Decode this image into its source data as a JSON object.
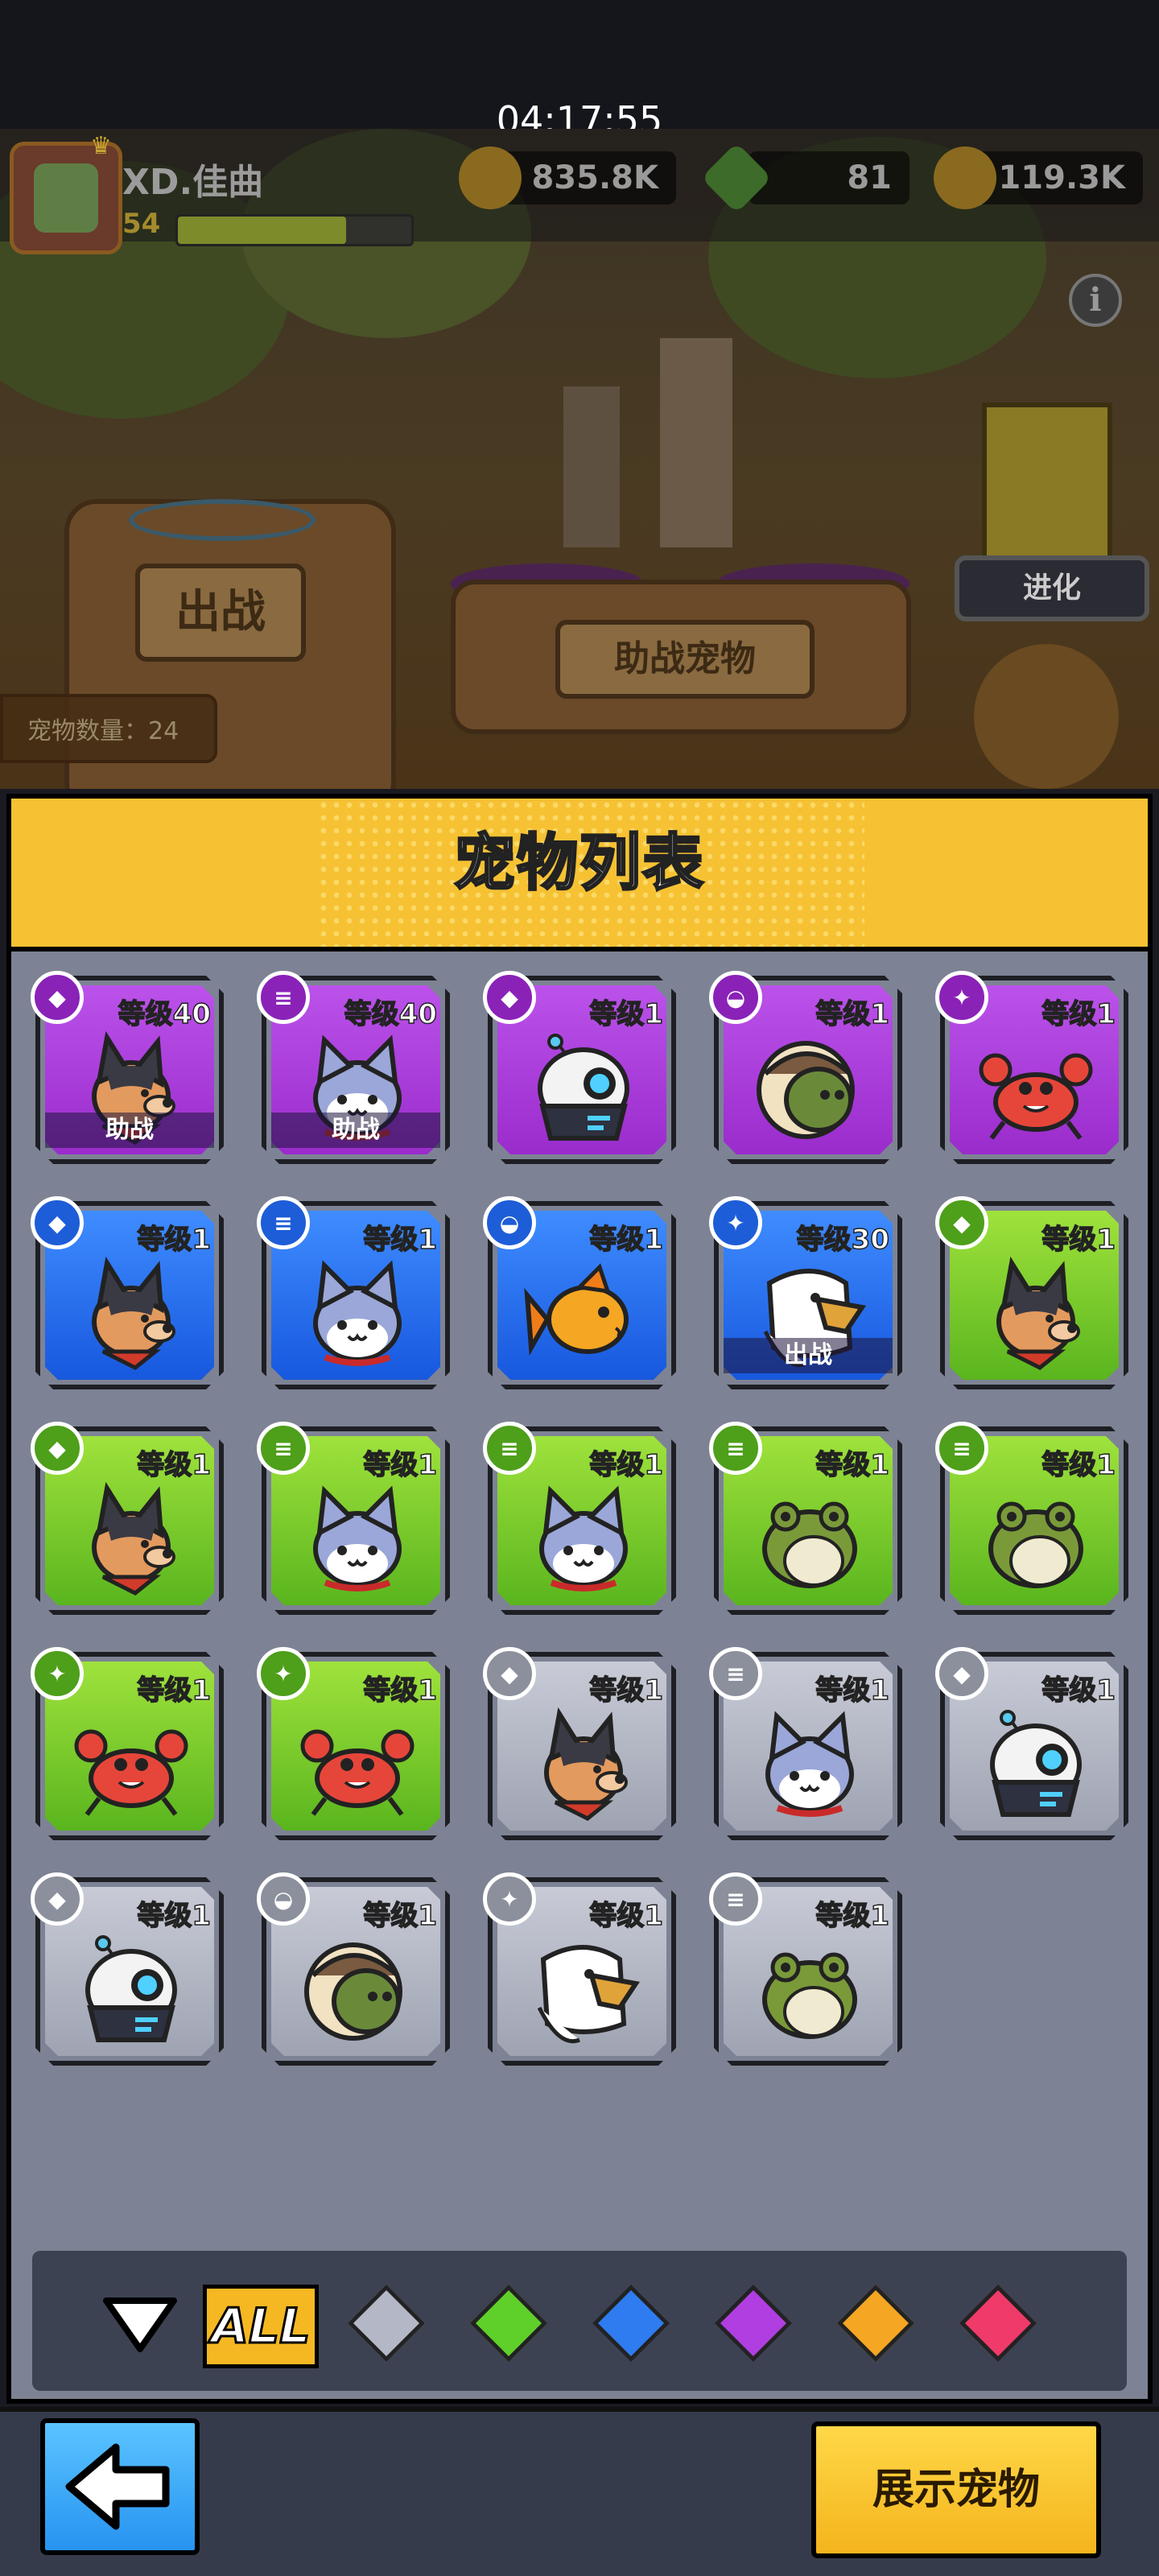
{
  "status_bar": {
    "time": "04:17:55"
  },
  "player": {
    "name": "XD.佳曲",
    "level": "54",
    "xp_fraction": 0.72
  },
  "resources": {
    "coins": "835.8K",
    "gems": "81",
    "gold": "119.3K"
  },
  "scene": {
    "battle_label": "出战",
    "assist_label": "助战宠物",
    "evolve_label": "进化",
    "pet_count_label": "宠物数量：24"
  },
  "panel": {
    "title": "宠物列表",
    "pets": [
      {
        "rarity": "purple",
        "pet": "dog",
        "badge": "dog-icon",
        "level": "等级40",
        "tag": "助战"
      },
      {
        "rarity": "purple",
        "pet": "cat",
        "badge": "coin-stack-icon",
        "level": "等级40",
        "tag": "助战"
      },
      {
        "rarity": "purple",
        "pet": "robot",
        "badge": "dog-icon",
        "level": "等级1",
        "tag": ""
      },
      {
        "rarity": "purple",
        "pet": "turtle",
        "badge": "turtle-icon",
        "level": "等级1",
        "tag": ""
      },
      {
        "rarity": "purple",
        "pet": "crab",
        "badge": "claw-icon",
        "level": "等级1",
        "tag": ""
      },
      {
        "rarity": "blue",
        "pet": "dog",
        "badge": "dog-icon",
        "level": "等级1",
        "tag": ""
      },
      {
        "rarity": "blue",
        "pet": "cat",
        "badge": "coin-stack-icon",
        "level": "等级1",
        "tag": ""
      },
      {
        "rarity": "blue",
        "pet": "fish",
        "badge": "turtle-icon",
        "level": "等级1",
        "tag": ""
      },
      {
        "rarity": "blue",
        "pet": "eagle",
        "badge": "claw-icon",
        "level": "等级30",
        "tag": "出战"
      },
      {
        "rarity": "green",
        "pet": "dog",
        "badge": "dog-icon",
        "level": "等级1",
        "tag": ""
      },
      {
        "rarity": "green",
        "pet": "dog",
        "badge": "dog-icon",
        "level": "等级1",
        "tag": ""
      },
      {
        "rarity": "green",
        "pet": "cat",
        "badge": "coin-stack-icon",
        "level": "等级1",
        "tag": ""
      },
      {
        "rarity": "green",
        "pet": "cat",
        "badge": "coin-stack-icon",
        "level": "等级1",
        "tag": ""
      },
      {
        "rarity": "green",
        "pet": "frog",
        "badge": "coin-stack-icon",
        "level": "等级1",
        "tag": ""
      },
      {
        "rarity": "green",
        "pet": "frog",
        "badge": "coin-stack-icon",
        "level": "等级1",
        "tag": ""
      },
      {
        "rarity": "green",
        "pet": "crab",
        "badge": "claw-icon",
        "level": "等级1",
        "tag": ""
      },
      {
        "rarity": "green",
        "pet": "crab",
        "badge": "claw-icon",
        "level": "等级1",
        "tag": ""
      },
      {
        "rarity": "gray",
        "pet": "dog",
        "badge": "dog-icon",
        "level": "等级1",
        "tag": ""
      },
      {
        "rarity": "gray",
        "pet": "cat",
        "badge": "coin-stack-icon",
        "level": "等级1",
        "tag": ""
      },
      {
        "rarity": "gray",
        "pet": "robot",
        "badge": "dog-icon",
        "level": "等级1",
        "tag": ""
      },
      {
        "rarity": "gray",
        "pet": "robot",
        "badge": "dog-icon",
        "level": "等级1",
        "tag": ""
      },
      {
        "rarity": "gray",
        "pet": "turtle",
        "badge": "turtle-icon",
        "level": "等级1",
        "tag": ""
      },
      {
        "rarity": "gray",
        "pet": "eagle",
        "badge": "claw-icon",
        "level": "等级1",
        "tag": ""
      },
      {
        "rarity": "gray",
        "pet": "frog",
        "badge": "coin-stack-icon",
        "level": "等级1",
        "tag": ""
      }
    ]
  },
  "filter": {
    "all_label": "ALL",
    "gems": [
      {
        "name": "gray",
        "color": "#b4b8c6"
      },
      {
        "name": "green",
        "color": "#5fd02a"
      },
      {
        "name": "blue",
        "color": "#2f7cf0"
      },
      {
        "name": "purple",
        "color": "#b03ee0"
      },
      {
        "name": "orange",
        "color": "#f5a623"
      },
      {
        "name": "red",
        "color": "#ef3a6a"
      }
    ]
  },
  "bottom": {
    "show_pets_label": "展示宠物"
  }
}
